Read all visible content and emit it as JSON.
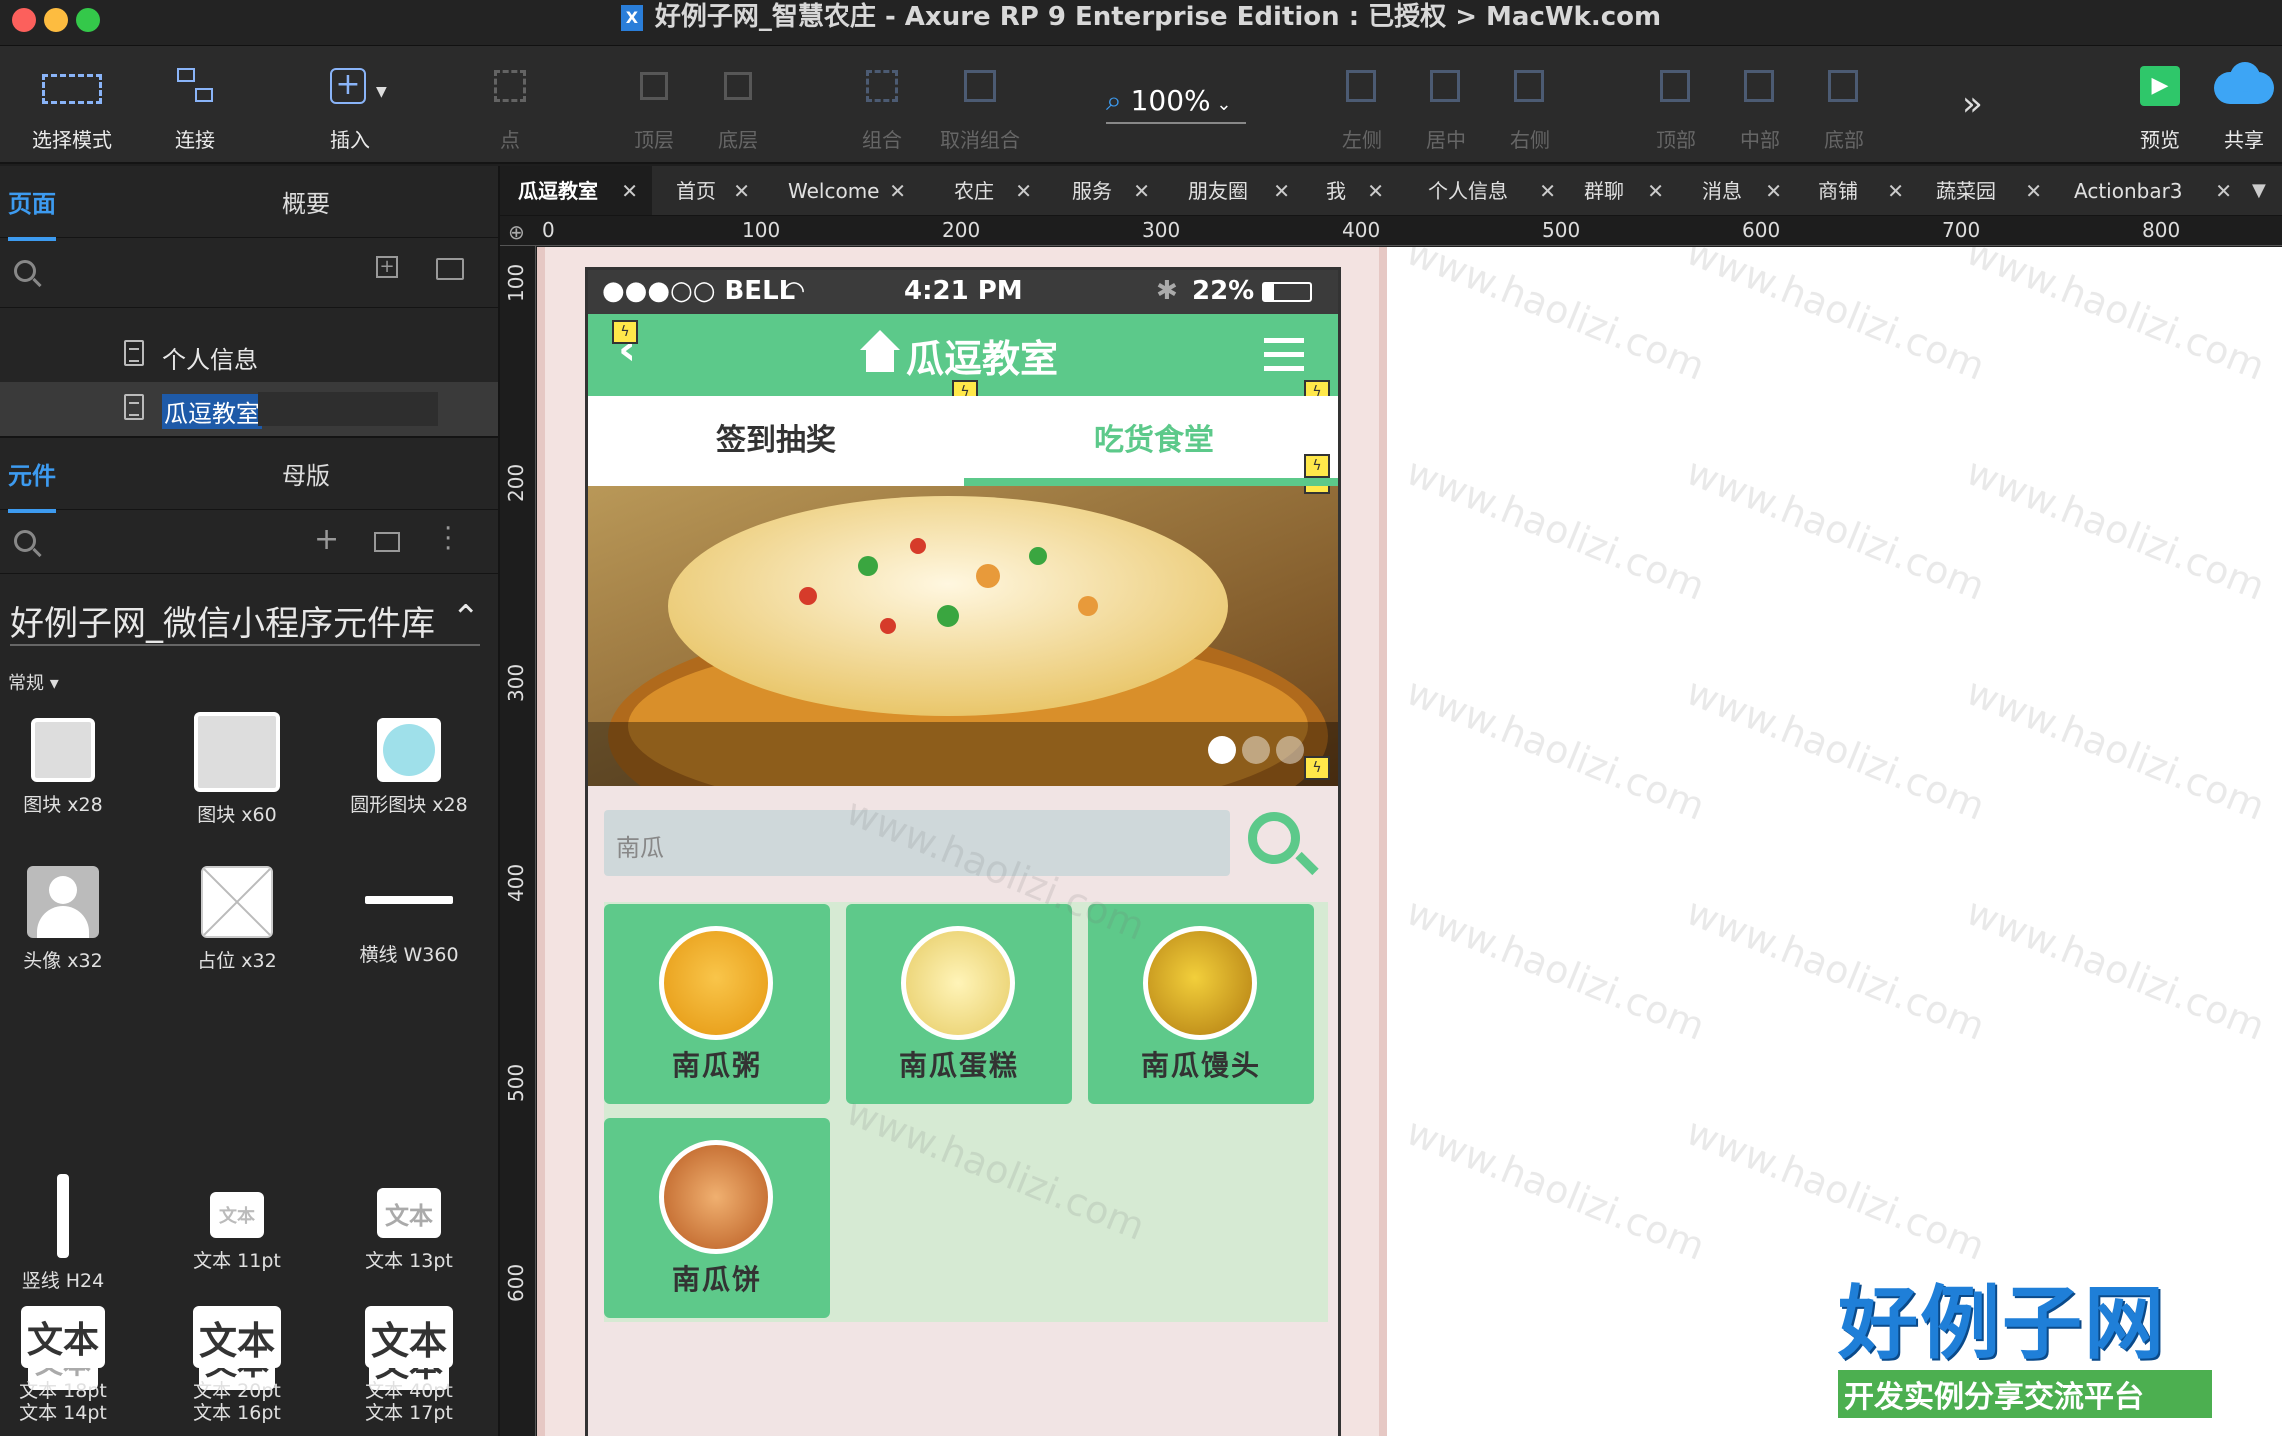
{
  "window": {
    "title": "好例子网_智慧农庄 - Axure RP 9 Enterprise Edition : 已授权 > MacWk.com",
    "app_icon": "X"
  },
  "toolbar": {
    "select_mode": "选择模式",
    "connect": "连接",
    "insert": "插入",
    "point": "点",
    "top_layer": "顶层",
    "bottom_layer": "底层",
    "group": "组合",
    "ungroup": "取消组合",
    "zoom": "100%",
    "align_left": "左侧",
    "align_center": "居中",
    "align_right": "右侧",
    "align_top": "顶部",
    "align_middle": "中部",
    "align_bottom": "底部",
    "preview": "预览",
    "share": "共享"
  },
  "left_panel": {
    "tabs": [
      "页面",
      "概要"
    ],
    "pages": [
      "个人信息",
      "瓜逗教室"
    ],
    "lib_tabs": [
      "元件",
      "母版"
    ],
    "library_name": "好例子网_微信小程序元件库",
    "category": "常规 ▾",
    "widgets": [
      "图块 x28",
      "图块 x60",
      "圆形图块 x28",
      "头像 x32",
      "占位 x32",
      "横线 W360",
      "竖线 H24",
      "文本 11pt",
      "文本 13pt",
      "文本 14pt",
      "文本 16pt",
      "文本 17pt",
      "文本 18pt",
      "文本 20pt",
      "文本 40pt"
    ],
    "widget_text": "文本"
  },
  "doc_tabs": [
    "瓜逗教室",
    "首页",
    "Welcome",
    "农庄",
    "服务",
    "朋友圈",
    "我",
    "个人信息",
    "群聊",
    "消息",
    "商铺",
    "蔬菜园",
    "Actionbar3"
  ],
  "ruler": {
    "h": [
      "0",
      "100",
      "200",
      "300",
      "400",
      "500",
      "600",
      "700",
      "800"
    ],
    "v": [
      "100",
      "200",
      "300",
      "400",
      "500",
      "600"
    ]
  },
  "phone": {
    "carrier": "●●●○○ BELL",
    "time": "4:21 PM",
    "battery": "22%",
    "nav_title": "瓜逗教室",
    "tabs": [
      "签到抽奖",
      "吃货食堂"
    ],
    "active_tab": 1,
    "search_placeholder": "南瓜",
    "foods": [
      "南瓜粥",
      "南瓜蛋糕",
      "南瓜馒头",
      "南瓜饼"
    ]
  },
  "watermark": "www.haolizi.com",
  "logo": {
    "main": "好例子网",
    "sub": "开发实例分享交流平台"
  },
  "colors": {
    "green": "#5cc98a",
    "accent_blue": "#3d9bf0"
  }
}
